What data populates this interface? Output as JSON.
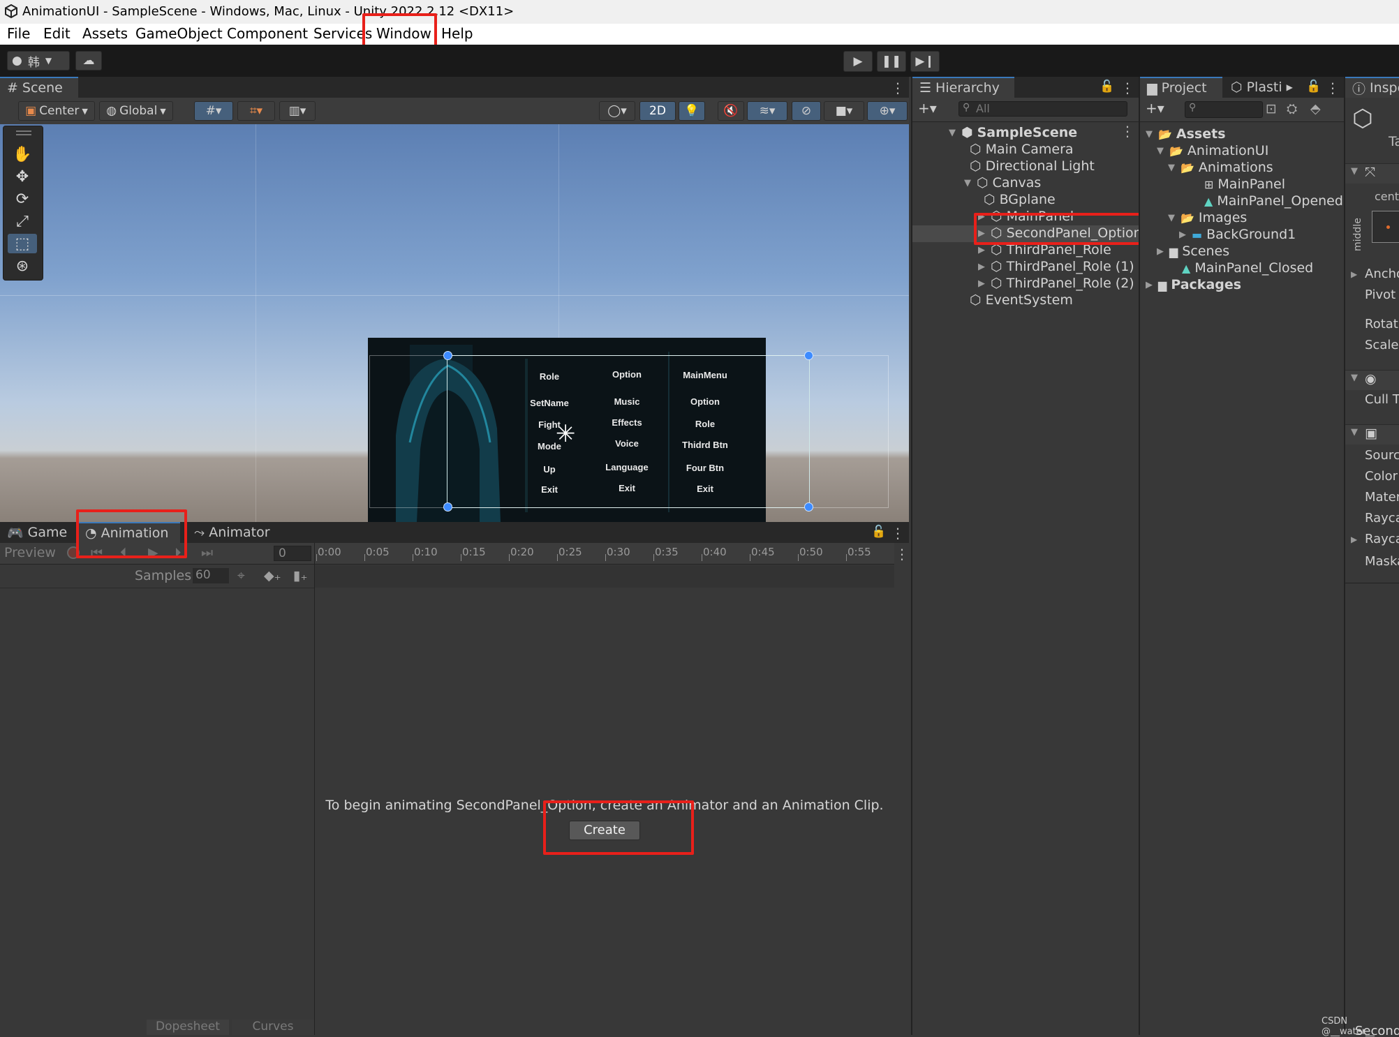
{
  "window": {
    "title": "AnimationUI - SampleScene - Windows, Mac, Linux - Unity 2022.2.12 <DX11>"
  },
  "menu": [
    "File",
    "Edit",
    "Assets",
    "GameObject",
    "Component",
    "Services",
    "Window",
    "Help"
  ],
  "toolbar": {
    "account_label": "韩",
    "play_icon": "play-icon",
    "pause_icon": "pause-icon",
    "step_icon": "step-icon"
  },
  "scene": {
    "tab_label": "Scene",
    "pivot_label": "Center",
    "space_label": "Global",
    "mode_2d_label": "2D",
    "ui_columns": [
      {
        "items": [
          "Role",
          "SetName",
          "Fight",
          "Mode",
          "Up",
          "Exit"
        ]
      },
      {
        "items": [
          "Option",
          "Music",
          "Effects",
          "Voice",
          "Language",
          "Exit"
        ]
      },
      {
        "items": [
          "MainMenu",
          "Option",
          "Role",
          "Thidrd Btn",
          "Four Btn",
          "Exit"
        ]
      }
    ]
  },
  "hierarchy": {
    "tab_label": "Hierarchy",
    "search_placeholder": "All",
    "scene_name": "SampleScene",
    "items": [
      {
        "label": "Main Camera"
      },
      {
        "label": "Directional Light"
      },
      {
        "label": "Canvas"
      },
      {
        "label": "BGplane"
      },
      {
        "label": "MainPanel"
      },
      {
        "label": "SecondPanel_Option"
      },
      {
        "label": "ThirdPanel_Role"
      },
      {
        "label": "ThirdPanel_Role (1)"
      },
      {
        "label": "ThirdPanel_Role (2)"
      },
      {
        "label": "EventSystem"
      }
    ]
  },
  "project": {
    "tab_label": "Project",
    "plastic_tab_label": "Plasti",
    "items": [
      {
        "label": "Assets"
      },
      {
        "label": "AnimationUI"
      },
      {
        "label": "Animations"
      },
      {
        "label": "MainPanel"
      },
      {
        "label": "MainPanel_Opened"
      },
      {
        "label": "Images"
      },
      {
        "label": "BackGround1"
      },
      {
        "label": "Scenes"
      },
      {
        "label": "MainPanel_Closed"
      },
      {
        "label": "Packages"
      }
    ]
  },
  "inspector": {
    "tab_label": "Inspe",
    "tag_fragment": "Ta",
    "anchor_fragment": "cente",
    "middle_label": "middle",
    "fields": [
      "Ancho",
      "Pivot",
      "Rotati",
      "Scale",
      "Cull T",
      "Sourc",
      "Color",
      "Mater",
      "Rayca",
      "Rayca",
      "Maska"
    ],
    "bottom_fragment": "Second"
  },
  "bottom_panel": {
    "tabs": [
      "Game",
      "Animation",
      "Animator"
    ],
    "preview_label": "Preview",
    "frame_value": "0",
    "samples_label": "Samples",
    "samples_value": "60",
    "timeline_marks": [
      "0:00",
      "0:05",
      "0:10",
      "0:15",
      "0:20",
      "0:25",
      "0:30",
      "0:35",
      "0:40",
      "0:45",
      "0:50",
      "0:55"
    ],
    "message": "To begin animating SecondPanel_Option, create an Animator and an Animation Clip.",
    "create_label": "Create",
    "footer_tabs": [
      "Dopesheet",
      "Curves"
    ]
  },
  "watermark": "CSDN @__water__"
}
